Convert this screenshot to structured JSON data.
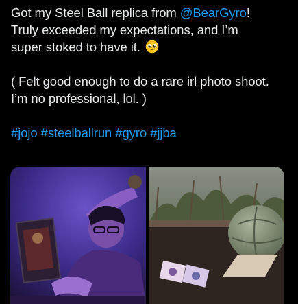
{
  "tweet": {
    "line1_prefix": "Got my Steel Ball replica from ",
    "mention": "@BearGyro",
    "line1_suffix": "!",
    "line2": "Truly exceeded my expectations, and I’m",
    "line3": "super stoked to have it.",
    "emoji_icon": "pleading-face-emoji",
    "line4": "( Felt good enough to do a rare irl photo shoot.",
    "line5": "I’m no professional, lol. )",
    "hashtags": [
      "#jojo",
      "#steelballrun",
      "#gyro",
      "#jjba"
    ]
  },
  "media": {
    "photo_left_icon": "selfie-photo",
    "photo_right_icon": "steel-ball-replica-photo"
  },
  "colors": {
    "background": "#000000",
    "text": "#e7e9ea",
    "link": "#1d9bf0"
  }
}
